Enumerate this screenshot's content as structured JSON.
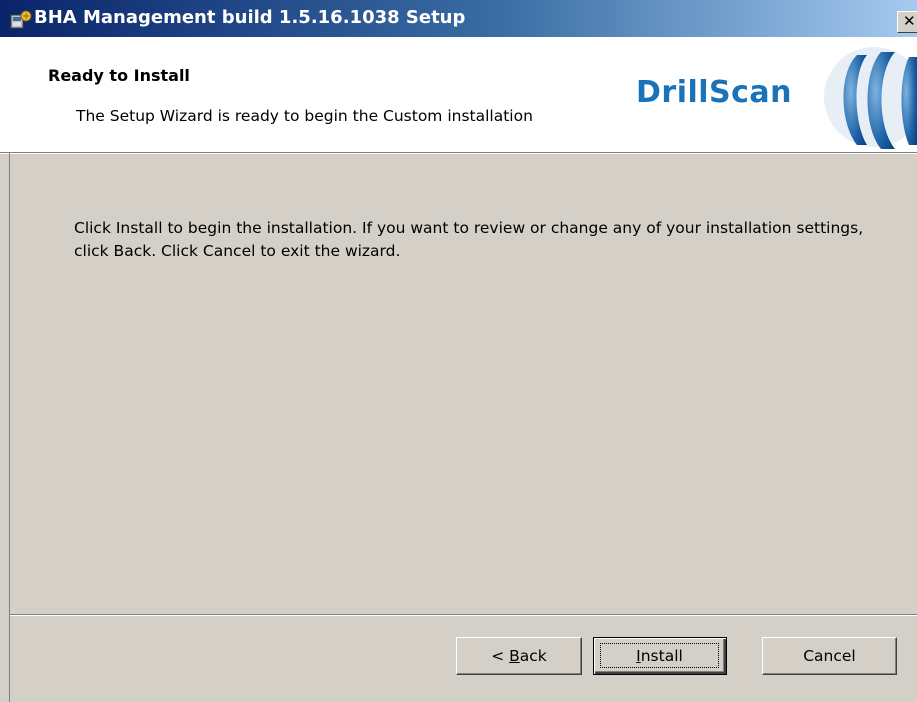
{
  "window": {
    "title": "BHA Management build 1.5.16.1038 Setup",
    "close_glyph": "✕"
  },
  "header": {
    "title": "Ready to Install",
    "description": "The Setup Wizard is ready to begin the Custom installation",
    "logo_text": "DrillScan"
  },
  "main": {
    "instructions": "Click Install to begin the installation. If you want to review or change any of your installation settings, click Back. Click Cancel to exit the wizard."
  },
  "buttons": {
    "back": {
      "prefix": "< ",
      "mnemonic": "B",
      "rest": "ack"
    },
    "install": {
      "mnemonic": "I",
      "rest": "nstall"
    },
    "cancel": "Cancel"
  },
  "colors": {
    "dialog_bg": "#d4d0c8",
    "titlebar_start": "#0a246a",
    "titlebar_end": "#a6caf0",
    "logo_blue": "#1a73b8"
  },
  "icons": {
    "title_icon": "setup-installer-icon",
    "logo_mark": "drillscan-arc-logo"
  }
}
